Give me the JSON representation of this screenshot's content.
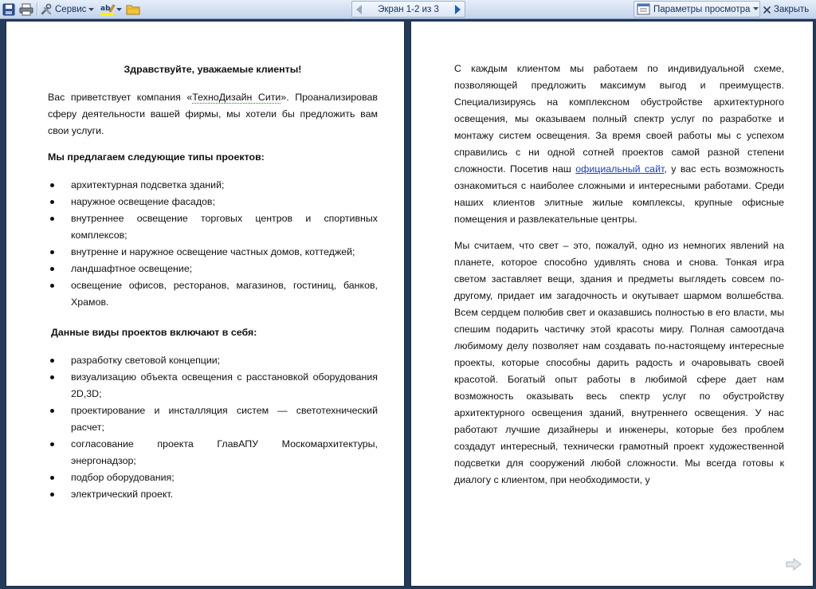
{
  "toolbar": {
    "icons": [
      "save-icon",
      "print-icon",
      "tools-icon",
      "highlight-icon",
      "folder-icon"
    ],
    "service_label": "Сервис",
    "screen_label": "Экран 1-2 из 3",
    "view_options_label": "Параметры просмотра",
    "close_label": "Закрыть",
    "accent_color": "#15305a"
  },
  "left_page": {
    "title": "Здравствуйте, уважаемые клиенты!",
    "intro_before": "Вас приветствует компания «",
    "intro_company": "ТехноДизайн Сити",
    "intro_after": "». Проанализировав сферу деятельности вашей фирмы, мы хотели бы предложить вам свои услуги.",
    "heading1": "Мы предлагаем следующие типы проектов:",
    "list1": [
      "архитектурная подсветка зданий;",
      "наружное освещение фасадов;",
      "внутреннее освещение торговых центров и спортивных комплексов;",
      "внутренне и наружное освещение частных домов, коттеджей;",
      "ландшафтное освещение;",
      "освещение офисов, ресторанов, магазинов, гостиниц, банков, Храмов."
    ],
    "heading2": "Данные виды проектов включают в себя:",
    "list2": [
      "разработку световой концепции;",
      "визуализацию объекта освещения с расстановкой оборудования 2D,3D;",
      "проектирование и инсталляция систем — светотехнический расчет;",
      "согласование проекта ГлавАПУ Москомархитектуры, энергонадзор;",
      "подбор оборудования;",
      "электрический проект."
    ]
  },
  "right_page": {
    "p1_before": "С каждым клиентом мы работаем по индивидуальной схеме, позволяющей предложить максимум выгод и преимуществ. Специализируясь на комплексном обустройстве архитектурного освещения, мы оказываем полный спектр услуг по разработке и монтажу систем освещения. За время своей работы мы с успехом справились с ни одной сотней проектов самой разной степени сложности. Посетив наш ",
    "p1_link": "официальный сайт",
    "p1_after": ", у вас есть возможность ознакомиться с наиболее сложными и интересными работами. Среди наших клиентов элитные жилые комплексы, крупные офисные помещения и развлекательные центры.",
    "p2": " Мы считаем, что свет – это, пожалуй, одно из немногих явлений на планете, которое способно удивлять снова и снова. Тонкая игра светом заставляет вещи, здания и предметы выглядеть совсем по-другому, придает им загадочность и окутывает шармом волшебства. Всем сердцем полюбив свет и оказавшись полностью в его власти, мы спешим подарить частичку этой красоты миру. Полная самоотдача любимому делу позволяет нам создавать по-настоящему интересные проекты, которые способны дарить радость и очаровывать своей красотой. Богатый опыт работы в любимой сфере дает нам возможность оказывать весь спектр услуг по обустройству архитектурного освещения зданий, внутреннего освещения. У нас работают лучшие дизайнеры и инженеры, которые без проблем создадут интересный, технически грамотный проект художественной подсветки для сооружений любой сложности. Мы всегда готовы к диалогу с клиентом, при необходимости, у"
  }
}
